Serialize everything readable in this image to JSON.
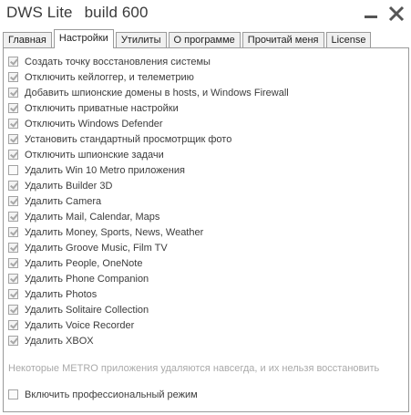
{
  "window": {
    "title": "DWS Lite",
    "build": "build 600",
    "minimize_icon": "minimize-icon",
    "close_icon": "close-icon"
  },
  "tabs": [
    {
      "label": "Главная",
      "active": false
    },
    {
      "label": "Настройки",
      "active": true
    },
    {
      "label": "Утилиты",
      "active": false
    },
    {
      "label": "О программе",
      "active": false
    },
    {
      "label": "Прочитай меня",
      "active": false
    },
    {
      "label": "License",
      "active": false
    }
  ],
  "options": [
    {
      "label": "Создать точку восстановления системы",
      "checked": true
    },
    {
      "label": "Отключить кейлоггер, и телеметрию",
      "checked": true
    },
    {
      "label": "Добавить шпионские домены в hosts, и Windows Firewall",
      "checked": true
    },
    {
      "label": "Отключить приватные настройки",
      "checked": true
    },
    {
      "label": "Отключить Windows Defender",
      "checked": true
    },
    {
      "label": "Установить стандартный просмотрщик фото",
      "checked": true
    },
    {
      "label": "Отключить шпионские задачи",
      "checked": true
    },
    {
      "label": "Удалить Win 10 Metro приложения",
      "checked": false
    },
    {
      "label": "Удалить Builder 3D",
      "checked": true
    },
    {
      "label": "Удалить Camera",
      "checked": true
    },
    {
      "label": "Удалить Mail, Calendar, Maps",
      "checked": true
    },
    {
      "label": "Удалить Money, Sports, News, Weather",
      "checked": true
    },
    {
      "label": "Удалить Groove Music, Film TV",
      "checked": true
    },
    {
      "label": "Удалить People, OneNote",
      "checked": true
    },
    {
      "label": "Удалить Phone Companion",
      "checked": true
    },
    {
      "label": "Удалить Photos",
      "checked": true
    },
    {
      "label": "Удалить Solitaire Collection",
      "checked": true
    },
    {
      "label": "Удалить Voice Recorder",
      "checked": true
    },
    {
      "label": "Удалить XBOX",
      "checked": true
    }
  ],
  "note": "Некоторые METRO приложения удаляются навсегда, и их нельзя восстановить",
  "pro_mode": {
    "label": "Включить профессиональный режим",
    "checked": false
  },
  "colors": {
    "title_text": "#3a3a3a",
    "note_text": "#a9a9a9",
    "border": "#9a9a9a",
    "checkmark": "#a8a8a8"
  }
}
